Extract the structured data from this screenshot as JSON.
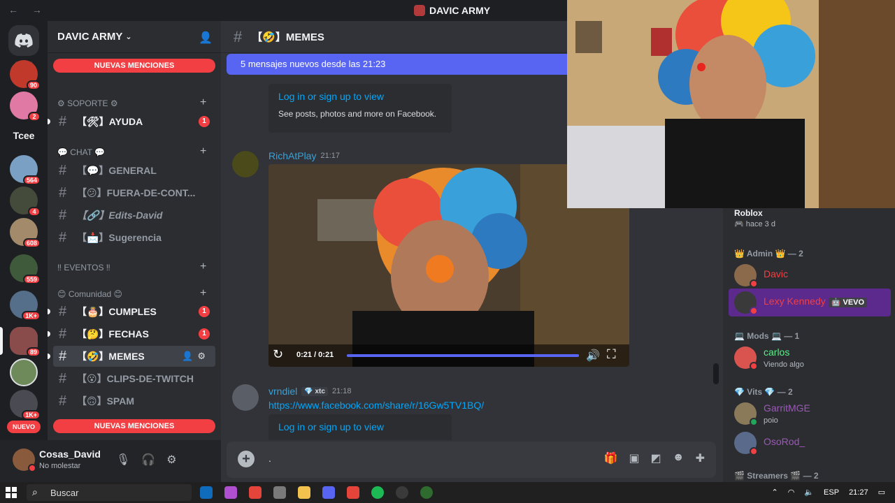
{
  "window": {
    "title": "DAVIC ARMY",
    "nav_arrows": "← →"
  },
  "rail": {
    "text_server": "Tcee",
    "new_label": "NUEVO",
    "servers": [
      {
        "count": "90",
        "color": "#c0392b"
      },
      {
        "count": "2",
        "color": "#e07aa5"
      },
      {
        "count": "564",
        "color": "#7aa0c4"
      },
      {
        "count": "4",
        "color": "#444b3a"
      },
      {
        "count": "608",
        "color": "#a38a6a"
      },
      {
        "count": "559",
        "color": "#3f5a3a"
      },
      {
        "count": "1K+",
        "color": "#556f8a"
      },
      {
        "count": "89",
        "color": "#8a4b4b"
      },
      {
        "count": "",
        "color": "#6e8a5a"
      },
      {
        "count": "1K+",
        "color": "#4a4a52"
      }
    ]
  },
  "sidebar": {
    "guild_name": "DAVIC ARMY",
    "mentions_banner": "NUEVAS MENCIONES",
    "categories": {
      "soporte": "⚙ SOPORTE ⚙",
      "chat": "💬 CHAT 💬",
      "eventos": "‼ EVENTOS ‼",
      "comunidad": "😊 Comunidad 😊"
    },
    "channels": {
      "ayuda": "【🛠】AYUDA",
      "general": "【💬】GENERAL",
      "fuera": "【😕】FUERA-DE-CONT...",
      "edits": "【🔗】Edits-David",
      "sugerencia": "【📩】Sugerencia",
      "cumples": "【🎂】CUMPLES",
      "fechas": "【🤔】FECHAS",
      "memes": "【🤣】MEMES",
      "clips": "【😮】CLIPS-DE-TWITCH",
      "spam": "【🙃】SPAM"
    },
    "badge_one": "1"
  },
  "user_panel": {
    "name": "Cosas_David",
    "status": "No molestar"
  },
  "chat": {
    "channel_title": "【🤣】MEMES",
    "new_messages": "5 mensajes nuevos desde las 21:23",
    "embed1": {
      "link": "Log in or sign up to view",
      "desc": "See posts, photos and more on Facebook."
    },
    "msg1": {
      "author": "RichAtPlay",
      "time": "21:17",
      "author_color": "#3ba1d6"
    },
    "video": {
      "time": "0:21 / 0:21",
      "progress": 1.0
    },
    "msg2": {
      "author": "vrndiel",
      "tag": "💎 xtc",
      "time": "21:18",
      "link": "https://www.facebook.com/share/r/16Gw5TV1BQ/",
      "author_color": "#3ba1d6"
    },
    "embed2": {
      "link": "Log in or sign up to view"
    },
    "composer_text": "."
  },
  "members": {
    "activity_game": "Roblox",
    "activity_time": "🎮 hace 3 d",
    "groups": {
      "admin": "👑 Admin 👑 — 2",
      "mods": "💻 Mods 💻 — 1",
      "vits": "💎 Vits 💎 — 2",
      "streamers": "🎬 Streamers 🎬 — 2"
    },
    "list": {
      "davic": {
        "name": "Davic",
        "color": "#f23f43"
      },
      "lexy": {
        "name": "Lexy Kennedy",
        "color": "#f23f43",
        "tag": "🤖 VEVO"
      },
      "carlos": {
        "name": "carlos",
        "sub": "Viendo algo",
        "color": "#57f287"
      },
      "garrit": {
        "name": "GarritMGE",
        "sub": "poio",
        "color": "#9b59b6"
      },
      "osorod": {
        "name": "OsoRod_",
        "color": "#9b59b6"
      }
    }
  },
  "taskbar": {
    "search_label": "Buscar",
    "lang": "ESP",
    "clock": "21:27"
  }
}
